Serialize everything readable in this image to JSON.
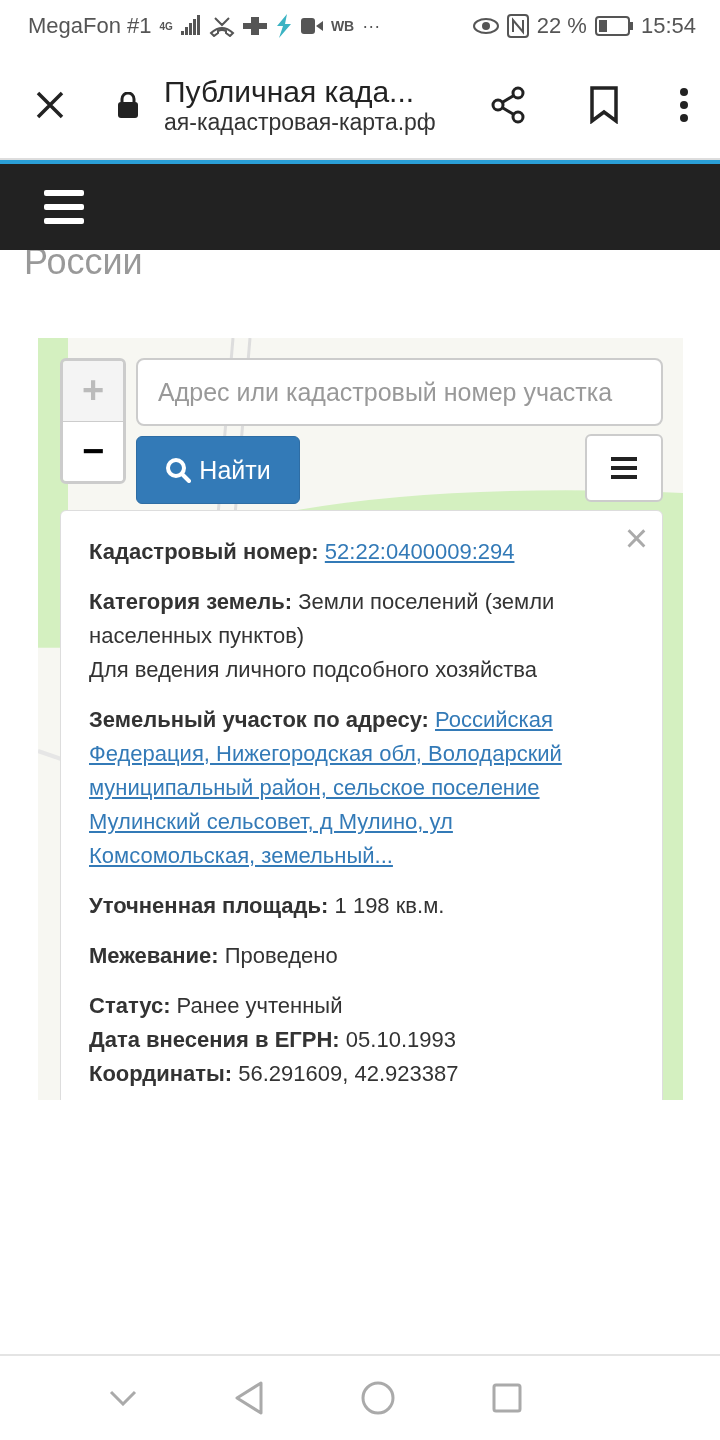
{
  "status_bar": {
    "carrier": "MegaFon #1",
    "network": "4G",
    "extra": "WB",
    "more": "···",
    "battery_percent": "22 %",
    "time": "15:54"
  },
  "browser": {
    "title": "Публичная када...",
    "url": "ая-кадастровая-карта.рф"
  },
  "page": {
    "heading": "России"
  },
  "map": {
    "zoom_in": "+",
    "zoom_out": "−",
    "zoom_in_disabled": true,
    "search_placeholder": "Адрес или кадастровый номер участка",
    "search_button": "Найти",
    "close": "×",
    "sections": [
      [
        {
          "kind": "link",
          "label": "Кадастровый номер:",
          "value": "52:22:0400009:294"
        }
      ],
      [
        {
          "kind": "text",
          "label": "Категория земель:",
          "value": "Земли поселений (земли населенных пунктов)"
        },
        {
          "kind": "text",
          "value": "Для ведения личного подсобного хозяйства"
        }
      ],
      [
        {
          "kind": "link_paragraph",
          "label": "Земельный участок по адресу:",
          "value": "Российская Федерация, Нижегородская обл, Володарский муниципальный район, сельское поселение Мулинский сельсовет, д Мулино, ул Комсомольская, земельный..."
        }
      ],
      [
        {
          "kind": "text",
          "label": "Уточненная площадь:",
          "value": "1 198 кв.м."
        }
      ],
      [
        {
          "kind": "text",
          "label": "Межевание:",
          "value": "Проведено"
        }
      ],
      [
        {
          "kind": "text",
          "label": "Статус:",
          "value": "Ранее учтенный"
        },
        {
          "kind": "text",
          "label": "Дата внесения в ЕГРН:",
          "value": "05.10.1993"
        },
        {
          "kind": "text",
          "label": "Координаты:",
          "value": "56.291609, 42.923387"
        }
      ]
    ]
  }
}
